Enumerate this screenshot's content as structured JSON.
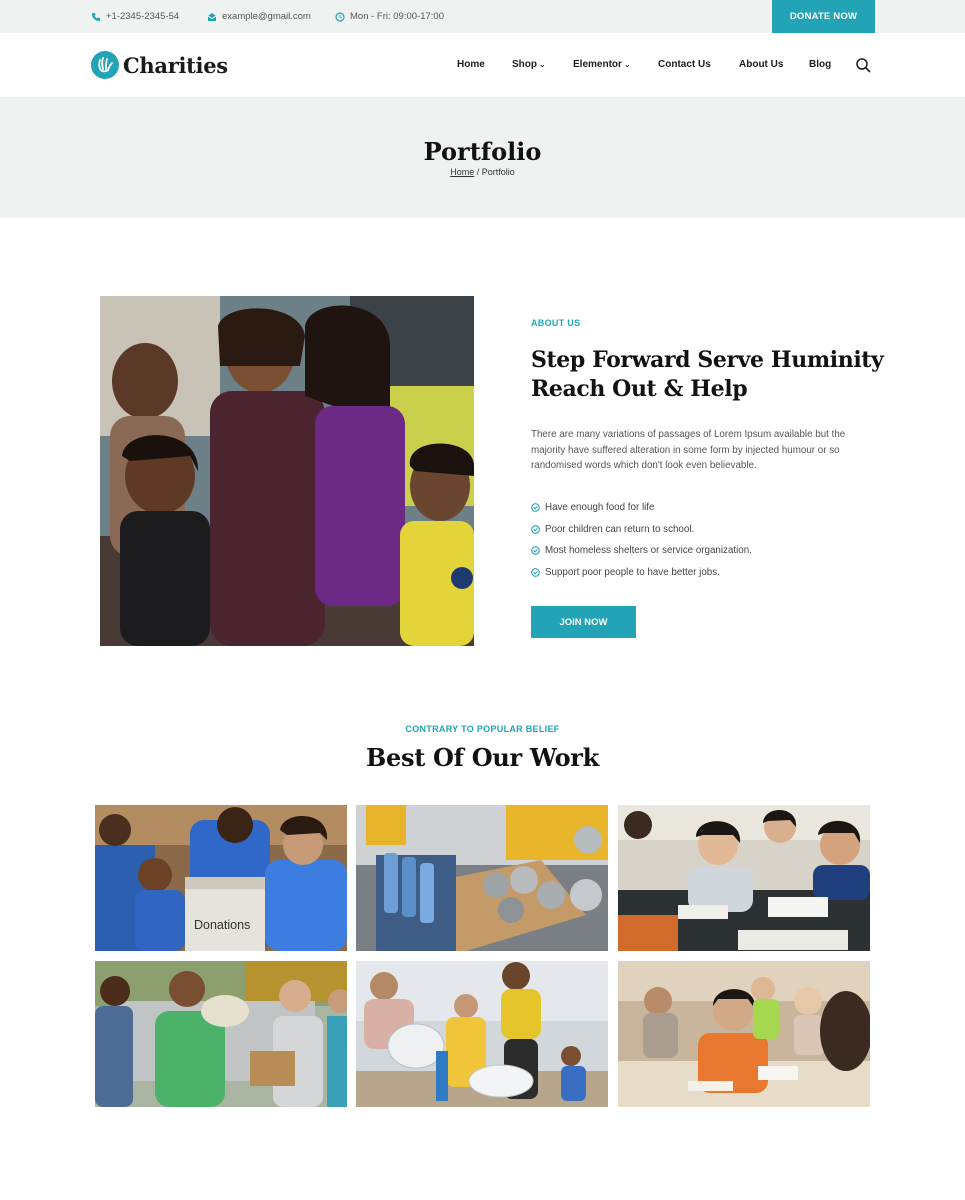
{
  "topbar": {
    "phone": "+1-2345-2345-54",
    "email": "example@gmail.com",
    "hours": "Mon - Fri: 09:00-17:00",
    "donate_label": "DONATE NOW"
  },
  "header": {
    "logo_text": "Charities",
    "nav": [
      "Home",
      "Shop",
      "Elementor",
      "Contact Us",
      "About Us",
      "Blog"
    ]
  },
  "pagehead": {
    "title": "Portfolio",
    "breadcrumb_home": "Home",
    "breadcrumb_sep": " / ",
    "breadcrumb_current": "Portfolio"
  },
  "about": {
    "label": "ABOUT US",
    "title": "Step Forward Serve Huminity Reach Out & Help",
    "text": "There are many variations of passages of Lorem Ipsum available but the majority have suffered alteration in some form by injected humour or so randomised words which don't look even believable.",
    "checklist": [
      "Have enough food for life",
      "Poor children can return to school.",
      "Most homeless shelters or service organization.",
      "Support poor people to have better jobs."
    ],
    "join_label": "JOIN NOW"
  },
  "work": {
    "label": "CONTRARY TO POPULAR BELIEF",
    "title": "Best Of Our Work",
    "donations_box_text": "Donations"
  },
  "colors": {
    "accent": "#22a3b6",
    "band_bg": "#eef2f1",
    "heading": "#121212"
  }
}
